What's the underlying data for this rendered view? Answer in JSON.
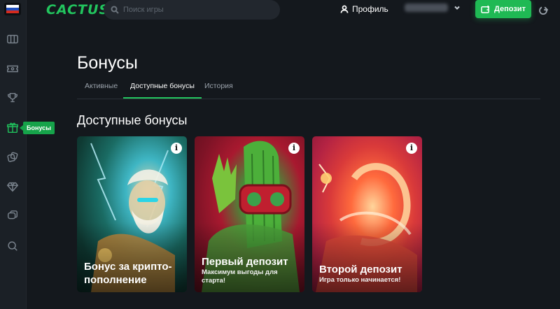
{
  "sidebar": {
    "flag_colors": [
      "#ffffff",
      "#1f4fbf",
      "#d52b1e"
    ],
    "icons": [
      "slot-icon",
      "ticket-icon",
      "trophy-icon",
      "gift-icon",
      "dice-icon",
      "diamond-icon",
      "chat-icon",
      "search-icon"
    ],
    "active": "gift-icon",
    "tooltip": "Бонусы"
  },
  "header": {
    "logo": "CACTUS",
    "search_placeholder": "Поиск игры",
    "profile_label": "Профиль",
    "deposit_label": "Депозит",
    "accent_color": "#1fb954"
  },
  "main": {
    "title": "Бонусы",
    "tabs": [
      {
        "label": "Активные",
        "active": false
      },
      {
        "label": "Доступные бонусы",
        "active": true
      },
      {
        "label": "История",
        "active": false
      }
    ],
    "section_title": "Доступные бонусы",
    "cards": [
      {
        "title_line1": "Бонус за крипто-",
        "title_line2": "пополнение",
        "subtitle_line1": "",
        "subtitle_line2": ""
      },
      {
        "title_line1": "Первый депозит",
        "title_line2": "",
        "subtitle_line1": "Максимум выгоды для",
        "subtitle_line2": "старта!"
      },
      {
        "title_line1": "Второй депозит",
        "title_line2": "",
        "subtitle_line1": "Игра только начинается!",
        "subtitle_line2": ""
      }
    ]
  }
}
